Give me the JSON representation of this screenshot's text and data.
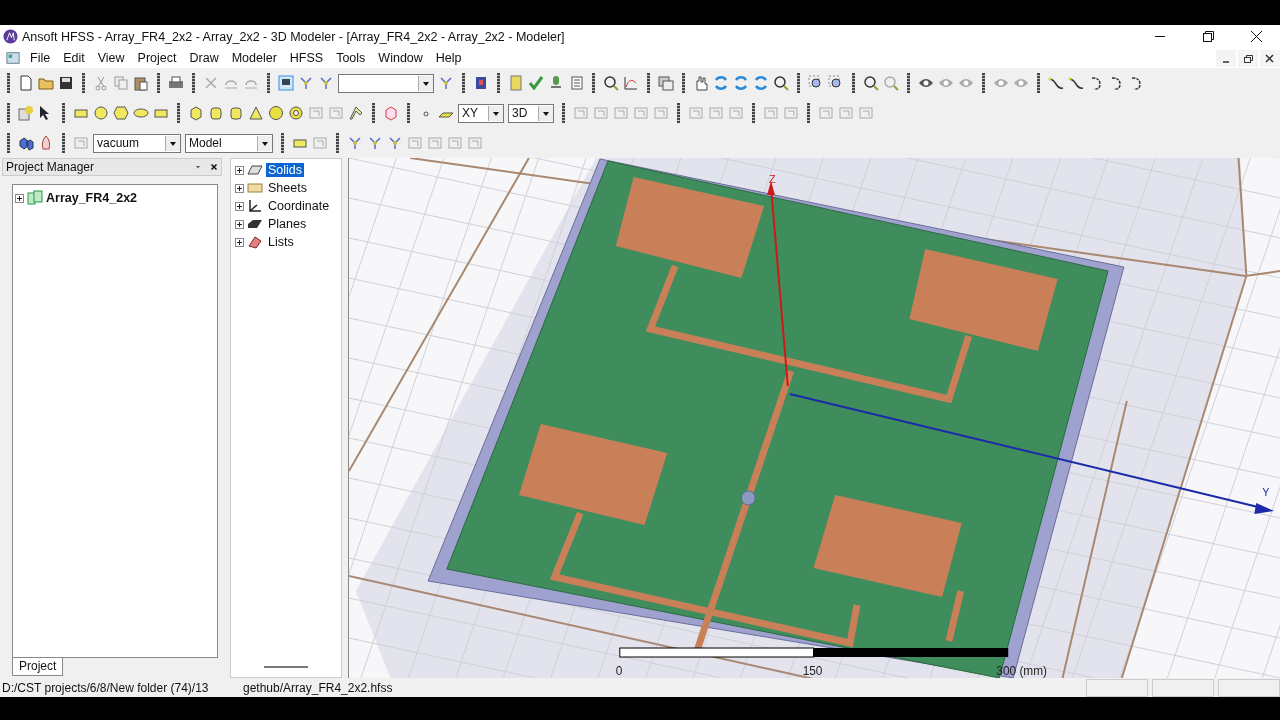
{
  "window": {
    "title": "Ansoft HFSS  - Array_FR4_2x2 - Array_2x2 - 3D Modeler - [Array_FR4_2x2 - Array_2x2 - Modeler]"
  },
  "menu": [
    "File",
    "Edit",
    "View",
    "Project",
    "Draw",
    "Modeler",
    "HFSS",
    "Tools",
    "Window",
    "Help"
  ],
  "toolbar": {
    "dropdowns": [
      {
        "value": "XY"
      },
      {
        "value": "3D"
      },
      {
        "value": "vacuum"
      },
      {
        "value": "Model"
      }
    ]
  },
  "project_manager": {
    "title": "Project Manager",
    "tree": [
      {
        "label": "Array_FR4_2x2",
        "expanded": false
      }
    ],
    "tabs": [
      {
        "label": "Project",
        "selected": true
      }
    ]
  },
  "model_tree": [
    {
      "label": "Solids",
      "selected": true,
      "expanded": false
    },
    {
      "label": "Sheets",
      "selected": false,
      "expanded": false
    },
    {
      "label": "Coordinate",
      "selected": false,
      "expanded": false
    },
    {
      "label": "Planes",
      "selected": false,
      "expanded": false
    },
    {
      "label": "Lists",
      "selected": false,
      "expanded": false
    }
  ],
  "viewport": {
    "axes": [
      {
        "label": "Z"
      },
      {
        "label": "Y"
      }
    ],
    "scale_labels": [
      "0",
      "150",
      "300 (mm)"
    ]
  },
  "status_bar": [
    "D:/CST projects/6/8/New folder (74)/13",
    "gethub/Array_FR4_2x2.hfss"
  ]
}
